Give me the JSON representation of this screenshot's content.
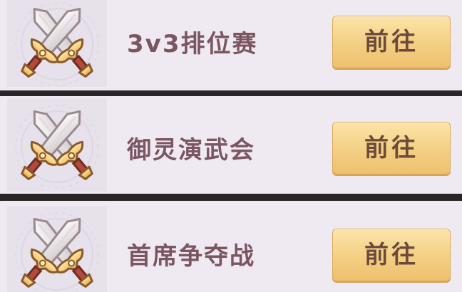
{
  "entries": [
    {
      "title": "3v3排位赛",
      "button_label": "前往",
      "icon": "crossed-swords-icon"
    },
    {
      "title": "御灵演武会",
      "button_label": "前往",
      "icon": "crossed-swords-icon"
    },
    {
      "title": "首席争夺战",
      "button_label": "前往",
      "icon": "crossed-swords-icon"
    }
  ],
  "colors": {
    "row_background": "#efeaf2",
    "separator": "#2a2628",
    "title_text": "#7b5560",
    "button_fill": "#f3cf83",
    "button_text": "#6e4a3a"
  }
}
